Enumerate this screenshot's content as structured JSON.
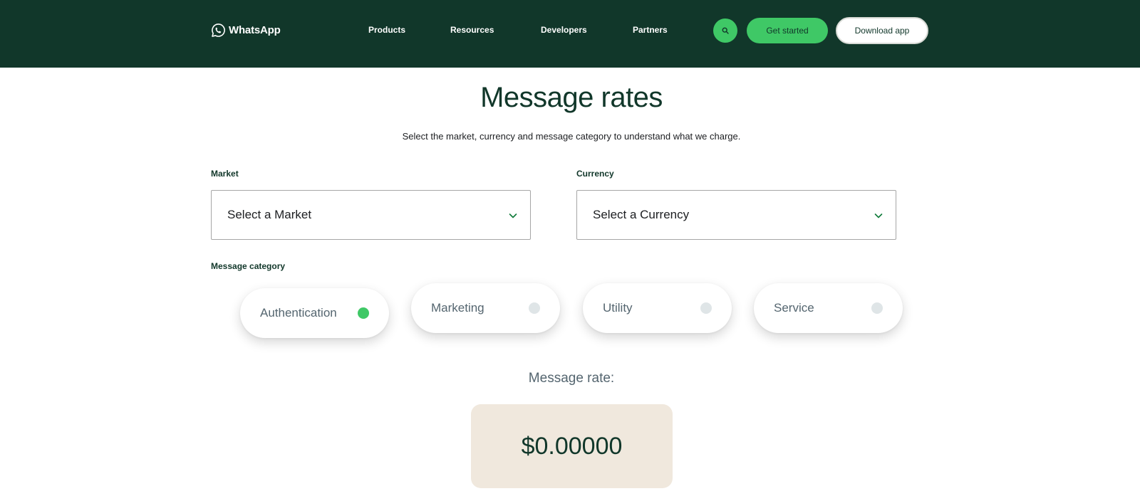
{
  "header": {
    "brand": "WhatsApp",
    "nav": [
      "Products",
      "Resources",
      "Developers",
      "Partners"
    ],
    "search_icon": "search-icon",
    "get_started_label": "Get started",
    "download_label": "Download app",
    "colors": {
      "header_bg": "#11372a",
      "accent": "#3fc866"
    }
  },
  "main": {
    "title": "Message rates",
    "subtitle": "Select the market, currency and message category to understand what we charge.",
    "market": {
      "label": "Market",
      "value": "Select a Market"
    },
    "currency": {
      "label": "Currency",
      "value": "Select a Currency"
    },
    "category_label": "Message category",
    "categories": [
      {
        "label": "Authentication",
        "selected": true
      },
      {
        "label": "Marketing",
        "selected": false
      },
      {
        "label": "Utility",
        "selected": false
      },
      {
        "label": "Service",
        "selected": false
      }
    ],
    "rate_label": "Message rate:",
    "rate_value": "$0.00000",
    "colors": {
      "rate_box_bg": "#f0e8dd",
      "selected_dot": "#3fc866",
      "unselected_dot": "#dfe5e7"
    }
  }
}
